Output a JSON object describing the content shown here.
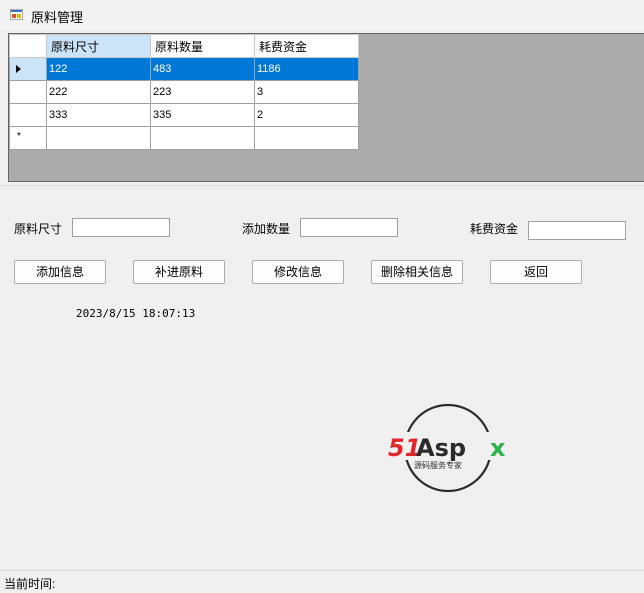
{
  "window": {
    "title": "原料管理"
  },
  "grid": {
    "columns": [
      "原料尺寸",
      "原料数量",
      "耗费资金"
    ],
    "rows": [
      [
        "122",
        "483",
        "1186"
      ],
      [
        "222",
        "223",
        "3"
      ],
      [
        "333",
        "335",
        "2"
      ]
    ],
    "new_row_marker": "*",
    "selected_row": 0
  },
  "form": {
    "size_label": "原料尺寸",
    "size_value": "",
    "qty_label": "添加数量",
    "qty_value": "",
    "cost_label": "耗费资金",
    "cost_value": ""
  },
  "buttons": {
    "add": "添加信息",
    "restock": "补进原料",
    "edit": "修改信息",
    "delete": "删除相关信息",
    "back": "返回"
  },
  "clock": "2023/8/15 18:07:13",
  "logo": {
    "brand": "51Aspx",
    "tagline": "源码服务专家"
  },
  "status": {
    "label": "当前时间:"
  },
  "colors": {
    "selection": "#0078d7",
    "logo_red": "#e3262a",
    "logo_green": "#2db34a"
  }
}
